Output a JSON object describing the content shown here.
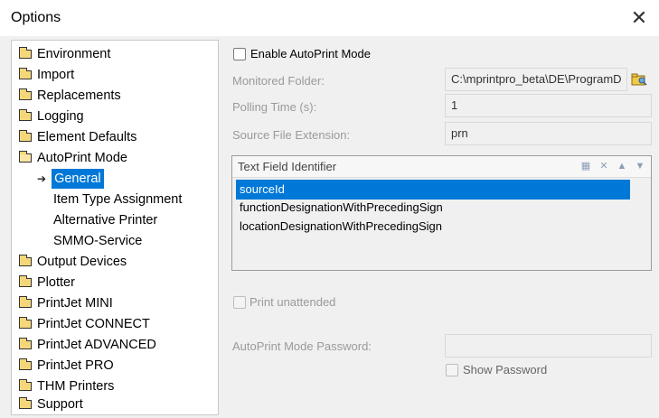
{
  "window": {
    "title": "Options",
    "close_glyph": "✕"
  },
  "tree": {
    "items": [
      {
        "label": "Environment",
        "icon": "folder-icon"
      },
      {
        "label": "Import",
        "icon": "folder-icon"
      },
      {
        "label": "Replacements",
        "icon": "folder-icon"
      },
      {
        "label": "Logging",
        "icon": "folder-icon"
      },
      {
        "label": "Element Defaults",
        "icon": "folder-icon"
      },
      {
        "label": "AutoPrint Mode",
        "icon": "folder-open-icon"
      },
      {
        "label": "General",
        "icon": "arrow-right-icon",
        "selected": true
      },
      {
        "label": "Item Type Assignment"
      },
      {
        "label": "Alternative Printer"
      },
      {
        "label": "SMMO-Service"
      },
      {
        "label": "Output Devices",
        "icon": "folder-icon"
      },
      {
        "label": "Plotter",
        "icon": "folder-icon"
      },
      {
        "label": "PrintJet MINI",
        "icon": "folder-icon"
      },
      {
        "label": "PrintJet CONNECT",
        "icon": "folder-icon"
      },
      {
        "label": "PrintJet ADVANCED",
        "icon": "folder-icon"
      },
      {
        "label": "PrintJet PRO",
        "icon": "folder-icon"
      },
      {
        "label": "THM Printers",
        "icon": "folder-icon"
      },
      {
        "label": "Support",
        "icon": "folder-icon"
      }
    ]
  },
  "settings": {
    "enable_autoprint_label": "Enable AutoPrint Mode",
    "monitored_folder_label": "Monitored Folder:",
    "monitored_folder_value": "C:\\mprintpro_beta\\DE\\ProgramD",
    "polling_time_label": "Polling Time (s):",
    "polling_time_value": "1",
    "source_ext_label": "Source File Extension:",
    "source_ext_value": "prn",
    "text_field_header": "Text Field Identifier",
    "text_fields": [
      "sourceId",
      "functionDesignationWithPrecedingSign",
      "locationDesignationWithPrecedingSign"
    ],
    "print_unattended_label": "Print unattended",
    "password_label": "AutoPrint Mode Password:",
    "password_value": "",
    "show_password_label": "Show Password"
  },
  "colors": {
    "selection": "#0078d7",
    "panel": "#f0f0f0"
  }
}
